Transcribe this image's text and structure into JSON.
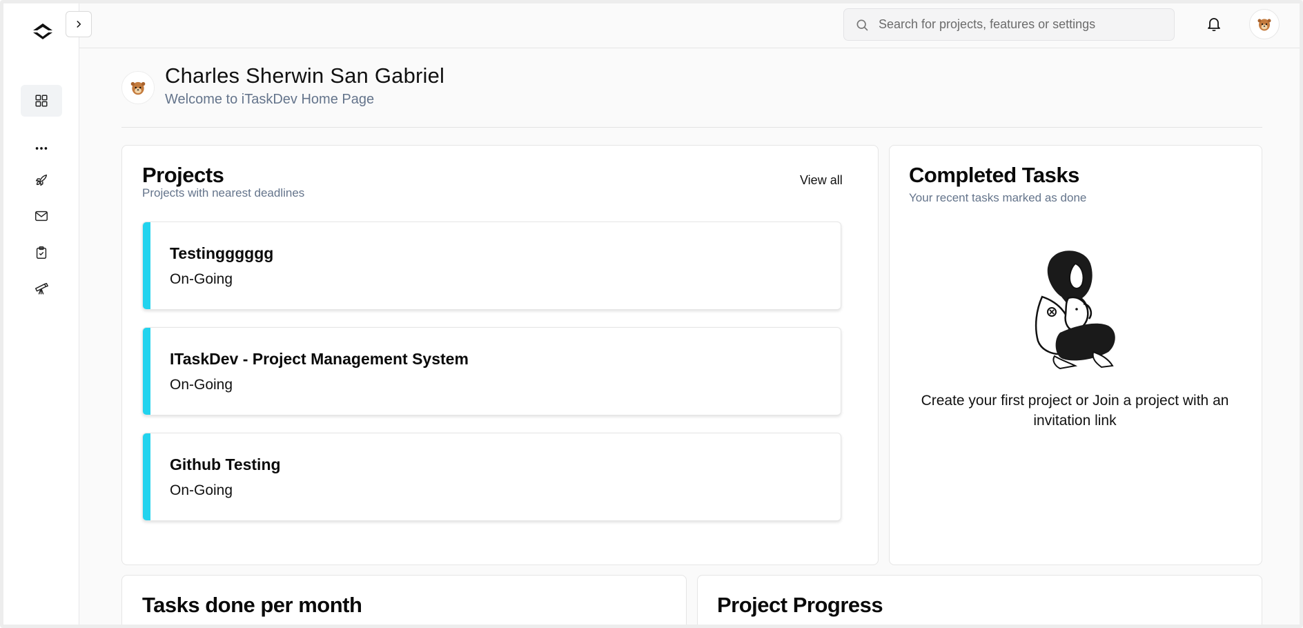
{
  "topbar": {
    "search_placeholder": "Search for projects, features or settings"
  },
  "sidebar": {
    "items": [
      {
        "icon": "dashboard-grid-icon"
      },
      {
        "icon": "more-dots-icon"
      },
      {
        "icon": "rocket-icon"
      },
      {
        "icon": "mail-icon"
      },
      {
        "icon": "clipboard-check-icon"
      },
      {
        "icon": "telescope-icon"
      }
    ]
  },
  "profile": {
    "name": "Charles Sherwin San Gabriel",
    "welcome": "Welcome to iTaskDev Home Page"
  },
  "projects_card": {
    "title": "Projects",
    "subtitle": "Projects with nearest deadlines",
    "view_all": "View all",
    "items": [
      {
        "name": "Testingggggg",
        "status": "On-Going"
      },
      {
        "name": "ITaskDev - Project Management System",
        "status": "On-Going"
      },
      {
        "name": "Github Testing",
        "status": "On-Going"
      }
    ],
    "accent_color": "#22d3ee"
  },
  "completed_card": {
    "title": "Completed Tasks",
    "subtitle": "Your recent tasks marked as done",
    "empty_message": "Create your first project or Join a project with an invitation link"
  },
  "tasks_card": {
    "title": "Tasks done per month"
  },
  "progress_card": {
    "title": "Project Progress"
  }
}
